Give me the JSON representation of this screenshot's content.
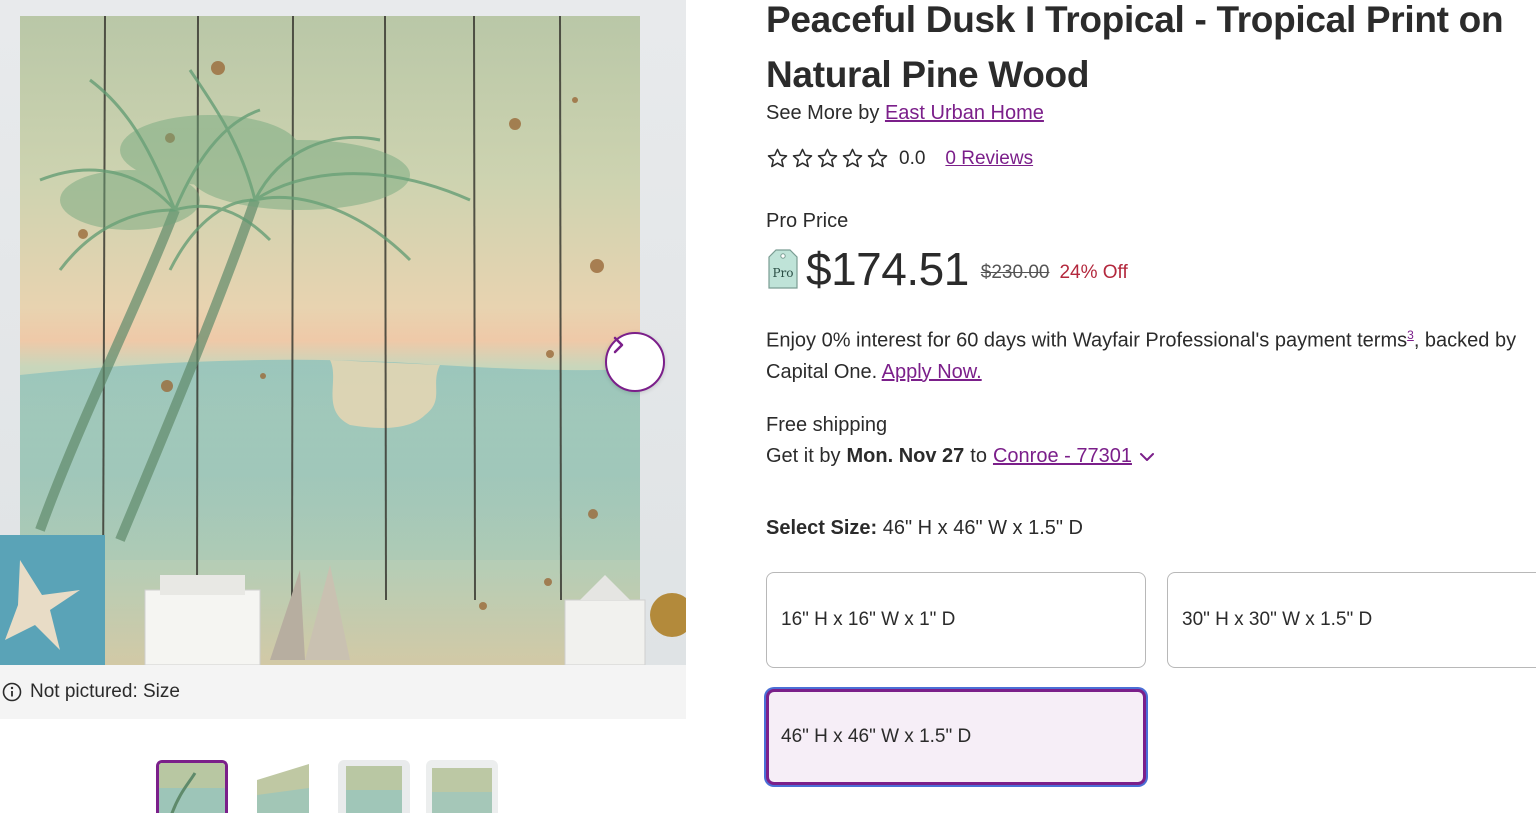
{
  "product": {
    "title_line1": "Peaceful Dusk I Tropical - Tropical Print on",
    "title_line2": "Natural Pine Wood",
    "see_more_prefix": "See More by",
    "brand": "East Urban Home",
    "rating_value": 0.0,
    "rating_text": "0.0",
    "reviews_link": "0 Reviews"
  },
  "pricing": {
    "label": "Pro Price",
    "badge_text": "Pro",
    "price": "$174.51",
    "was_price": "$230.00",
    "discount": "24% Off"
  },
  "financing": {
    "text_1": "Enjoy 0% interest for 60 days with Wayfair Professional's payment terms",
    "footnote": "3",
    "text_2": ", backed by",
    "text_3": "Capital One.",
    "apply_link": "Apply Now."
  },
  "shipping": {
    "free": "Free shipping",
    "get_it_by": "Get it by",
    "date": "Mon. Nov 27",
    "to": "to",
    "location": "Conroe - 77301"
  },
  "size": {
    "label": "Select Size:",
    "selected": "46\" H x 46\" W x 1.5\" D",
    "options": [
      "16\" H x 16\" W x 1\" D",
      "30\" H x 30\" W x 1.5\" D",
      "46\" H x 46\" W x 1.5\" D"
    ]
  },
  "media": {
    "not_pictured": "Not pictured: Size",
    "next_icon": "chevron-right-icon",
    "info_icon": "info-circle-icon"
  },
  "colors": {
    "accent": "#7b1f8a",
    "discount": "#b3283d",
    "focus": "#4b6fd6",
    "pro_badge": "#bfe3d8"
  }
}
